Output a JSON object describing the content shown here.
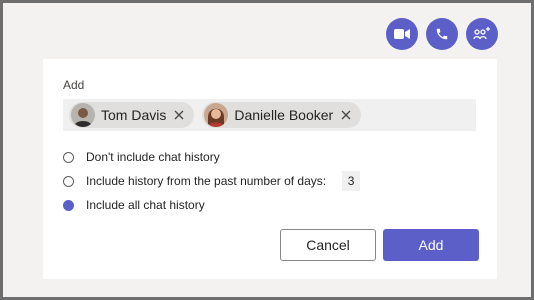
{
  "top_actions": [
    {
      "icon": "video-camera-icon"
    },
    {
      "icon": "phone-icon"
    },
    {
      "icon": "add-people-icon"
    }
  ],
  "dialog": {
    "title": "Add",
    "people": [
      {
        "name": "Tom Davis",
        "avatar": "avatar-tom-davis"
      },
      {
        "name": "Danielle Booker",
        "avatar": "avatar-danielle-booker"
      }
    ],
    "options": {
      "no_history": "Don't include chat history",
      "days_history": "Include history from the past number of days:",
      "days_value": "3",
      "all_history": "Include all chat history",
      "selected": "all_history"
    },
    "cancel_label": "Cancel",
    "add_label": "Add"
  },
  "colors": {
    "accent": "#5b5fc7",
    "frame_border": "#6e6e6e",
    "background": "#f3f2f1"
  }
}
